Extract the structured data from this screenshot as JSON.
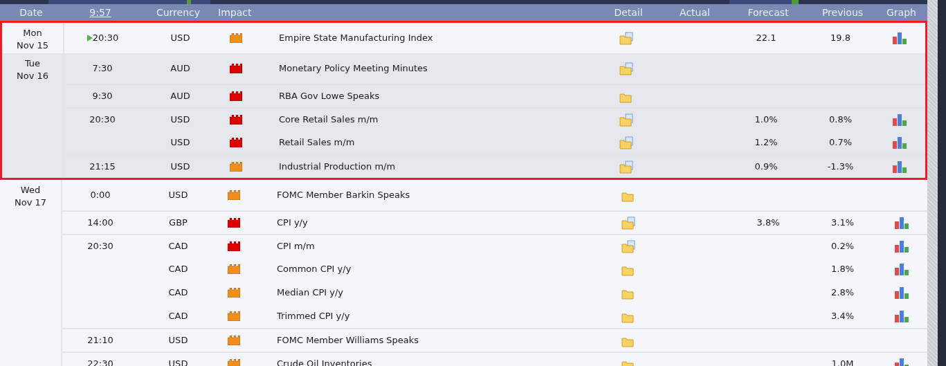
{
  "header": {
    "columns": [
      {
        "label": "Date",
        "kind": "text"
      },
      {
        "label": "9:57",
        "kind": "link"
      },
      {
        "label": "Currency",
        "kind": "text"
      },
      {
        "label": "Impact",
        "kind": "text"
      },
      {
        "label": "Detail",
        "kind": "text"
      },
      {
        "label": "Actual",
        "kind": "text"
      },
      {
        "label": "Forecast",
        "kind": "text"
      },
      {
        "label": "Previous",
        "kind": "text"
      },
      {
        "label": "Graph",
        "kind": "text"
      }
    ]
  },
  "days": [
    {
      "day": "Mon",
      "date": "Nov 15",
      "highlighted": true,
      "today": false,
      "events": [
        {
          "time": "20:30",
          "next": true,
          "currency": "USD",
          "color": "#ee8e1c",
          "title": "Empire State Manufacturing Index",
          "kind": "document",
          "forecast": "22.1",
          "previous": "19.8",
          "graph": true
        }
      ]
    },
    {
      "day": "Tue",
      "date": "Nov 16",
      "highlighted": true,
      "today": true,
      "events": [
        {
          "time": "7:30",
          "next": false,
          "currency": "AUD",
          "color": "#dd0000",
          "title": "Monetary Policy Meeting Minutes",
          "kind": "document",
          "graph": false
        },
        {
          "time": "9:30",
          "next": false,
          "currency": "AUD",
          "color": "#dd0000",
          "title": "RBA Gov Lowe Speaks",
          "kind": "folder",
          "graph": false
        },
        {
          "time": "20:30",
          "next": false,
          "currency": "USD",
          "color": "#dd0000",
          "title": "Core Retail Sales m/m",
          "kind": "document",
          "forecast": "1.0%",
          "previous": "0.8%",
          "graph": true
        },
        {
          "next": false,
          "currency": "USD",
          "color": "#dd0000",
          "title": "Retail Sales m/m",
          "kind": "document",
          "forecast": "1.2%",
          "previous": "0.7%",
          "graph": true
        },
        {
          "time": "21:15",
          "next": false,
          "currency": "USD",
          "color": "#ee8e1c",
          "title": "Industrial Production m/m",
          "kind": "document",
          "forecast": "0.9%",
          "previous": "-1.3%",
          "graph": true
        }
      ]
    },
    {
      "day": "Wed",
      "date": "Nov 17",
      "highlighted": false,
      "today": false,
      "events": [
        {
          "time": "0:00",
          "next": false,
          "currency": "USD",
          "color": "#ee8e1c",
          "title": "FOMC Member Barkin Speaks",
          "kind": "folder",
          "graph": false
        },
        {
          "time": "14:00",
          "next": false,
          "currency": "GBP",
          "color": "#dd0000",
          "title": "CPI y/y",
          "kind": "document",
          "forecast": "3.8%",
          "previous": "3.1%",
          "graph": true
        },
        {
          "time": "20:30",
          "next": false,
          "currency": "CAD",
          "color": "#dd0000",
          "title": "CPI m/m",
          "kind": "document",
          "previous": "0.2%",
          "graph": true
        },
        {
          "next": false,
          "currency": "CAD",
          "color": "#ee8e1c",
          "title": "Common CPI y/y",
          "kind": "folder",
          "previous": "1.8%",
          "graph": true
        },
        {
          "next": false,
          "currency": "CAD",
          "color": "#ee8e1c",
          "title": "Median CPI y/y",
          "kind": "folder",
          "previous": "2.8%",
          "graph": true
        },
        {
          "next": false,
          "currency": "CAD",
          "color": "#ee8e1c",
          "title": "Trimmed CPI y/y",
          "kind": "folder",
          "previous": "3.4%",
          "graph": true
        },
        {
          "time": "21:10",
          "next": false,
          "currency": "USD",
          "color": "#ee8e1c",
          "title": "FOMC Member Williams Speaks",
          "kind": "folder",
          "graph": false
        },
        {
          "time": "22:30",
          "next": false,
          "currency": "USD",
          "color": "#ee8e1c",
          "title": "Crude Oil Inventories",
          "kind": "folder",
          "previous": "1.0M",
          "graph": true
        }
      ]
    }
  ]
}
